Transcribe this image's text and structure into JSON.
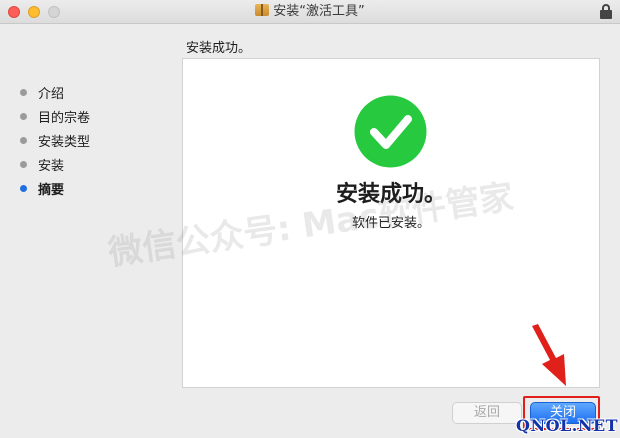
{
  "window": {
    "title": "安装“激活工具”"
  },
  "heading": "安装成功。",
  "sidebar": {
    "items": [
      {
        "label": "介绍"
      },
      {
        "label": "目的宗卷"
      },
      {
        "label": "安装类型"
      },
      {
        "label": "安装"
      },
      {
        "label": "摘要"
      }
    ],
    "active_index": 4
  },
  "main": {
    "success_title": "安装成功。",
    "success_message": "软件已安装。"
  },
  "buttons": {
    "back_label": "返回",
    "close_label": "关闭"
  },
  "overlay": {
    "watermark": "微信公众号: Mac软件管家",
    "brand": "QNOL.NET"
  },
  "colors": {
    "success_green": "#27c93f",
    "accent_blue": "#1f6fe0",
    "annotation_red": "#e0211b"
  }
}
